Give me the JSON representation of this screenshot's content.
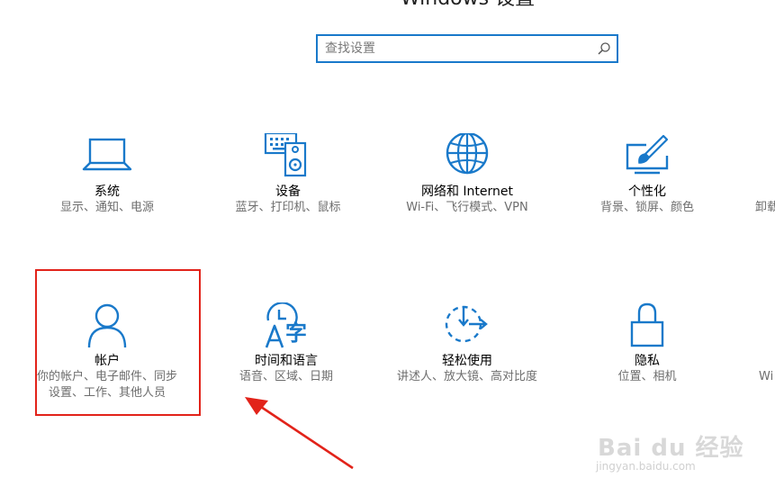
{
  "window": {
    "title": "Windows 设置"
  },
  "search": {
    "placeholder": "查找设置",
    "value": ""
  },
  "tiles": [
    {
      "label": "系统",
      "desc": [
        "显示、通知、电源"
      ],
      "icon": "laptop-icon"
    },
    {
      "label": "设备",
      "desc": [
        "蓝牙、打印机、鼠标"
      ],
      "icon": "keyboard-speaker-icon"
    },
    {
      "label": "网络和 Internet",
      "desc": [
        "Wi-Fi、飞行模式、VPN"
      ],
      "icon": "globe-icon"
    },
    {
      "label": "个性化",
      "desc": [
        "背景、锁屏、颜色"
      ],
      "icon": "paintbrush-icon"
    },
    {
      "label": "",
      "desc": [
        "卸载"
      ],
      "icon": "apps-icon"
    },
    {
      "label": "帐户",
      "desc": [
        "你的帐户、电子邮件、同步",
        "设置、工作、其他人员"
      ],
      "icon": "person-icon"
    },
    {
      "label": "时间和语言",
      "desc": [
        "语音、区域、日期"
      ],
      "icon": "time-language-icon"
    },
    {
      "label": "轻松使用",
      "desc": [
        "讲述人、放大镜、高对比度"
      ],
      "icon": "ease-of-access-icon"
    },
    {
      "label": "隐私",
      "desc": [
        "位置、相机"
      ],
      "icon": "lock-icon"
    },
    {
      "label": "",
      "desc": [
        "Wi"
      ],
      "icon": "update-icon"
    }
  ],
  "watermark": {
    "brand": "Bai du 经验",
    "url": "jingyan.baidu.com"
  },
  "colors": {
    "accent": "#1979ca",
    "highlight": "#e2231a",
    "description": "#6d6d6d"
  }
}
